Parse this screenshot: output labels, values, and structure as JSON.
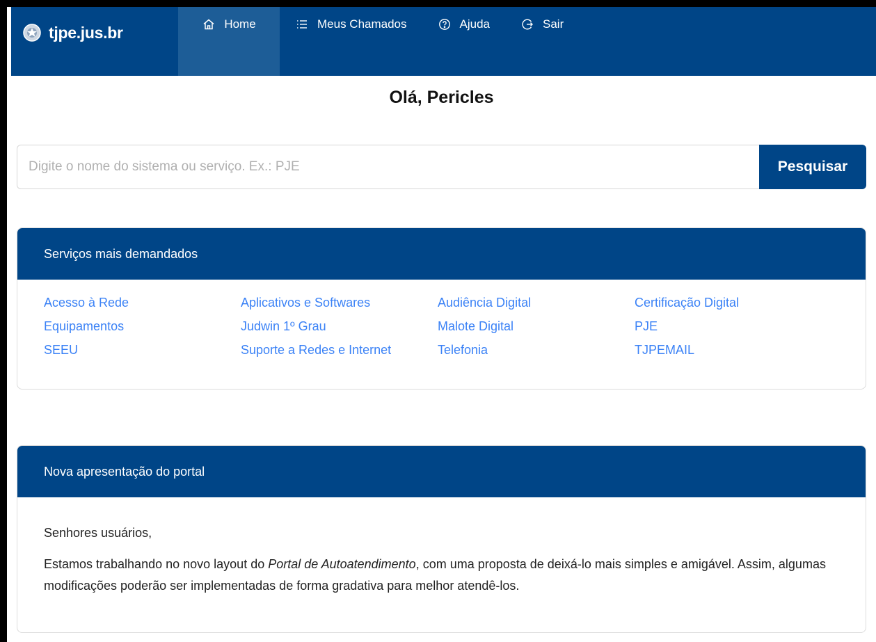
{
  "header": {
    "brand": "tjpe.jus.br",
    "nav": [
      {
        "label": "Home",
        "icon": "home-icon",
        "active": true
      },
      {
        "label": "Meus Chamados",
        "icon": "list-icon",
        "active": false
      },
      {
        "label": "Ajuda",
        "icon": "help-circle-icon",
        "active": false
      },
      {
        "label": "Sair",
        "icon": "logout-icon",
        "active": false
      }
    ],
    "colors": {
      "bar": "#004587",
      "active": "#1d5d97"
    }
  },
  "greeting": "Olá, Pericles",
  "search": {
    "placeholder": "Digite o nome do sistema ou serviço. Ex.: PJE",
    "value": "",
    "button_label": "Pesquisar"
  },
  "services": {
    "title": "Serviços mais demandados",
    "items": [
      "Acesso à Rede",
      "Aplicativos e Softwares",
      "Audiência Digital",
      "Certificação Digital",
      "Equipamentos",
      "Judwin 1º Grau",
      "Malote Digital",
      "PJE",
      "SEEU",
      "Suporte a Redes e Internet",
      "Telefonia",
      "TJPEMAIL"
    ]
  },
  "news": {
    "title": "Nova apresentação do portal",
    "greeting": "Senhores usuários,",
    "text_before": "Estamos trabalhando no novo layout do ",
    "text_emphasis": "Portal de Autoatendimento",
    "text_after": ", com uma proposta de deixá-lo mais simples e amigável. Assim, algumas modificações poderão ser implementadas de forma gradativa para melhor atendê-los."
  }
}
